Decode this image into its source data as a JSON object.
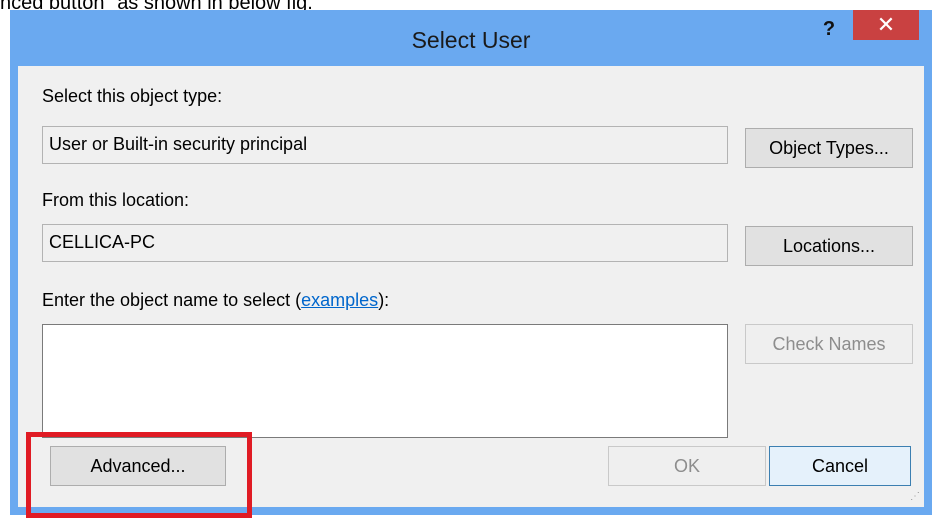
{
  "caption": "nced button\" as shown in below fig.",
  "window": {
    "title": "Select User",
    "help_label": "?",
    "close_label": "✕"
  },
  "object_type": {
    "label": "Select this object type:",
    "value": "User or Built-in security principal",
    "button": "Object Types..."
  },
  "location": {
    "label": "From this location:",
    "value": "CELLICA-PC",
    "button": "Locations..."
  },
  "object_name": {
    "label_prefix": "Enter the object name to select (",
    "link": "examples",
    "label_suffix": "):",
    "value": "",
    "check_button": "Check Names"
  },
  "footer": {
    "advanced_button": "Advanced...",
    "ok_button": "OK",
    "cancel_button": "Cancel"
  },
  "colors": {
    "title_bar": "#6aa9f0",
    "close_button": "#c94141",
    "highlight": "#e01b24",
    "link": "#0066cc"
  }
}
